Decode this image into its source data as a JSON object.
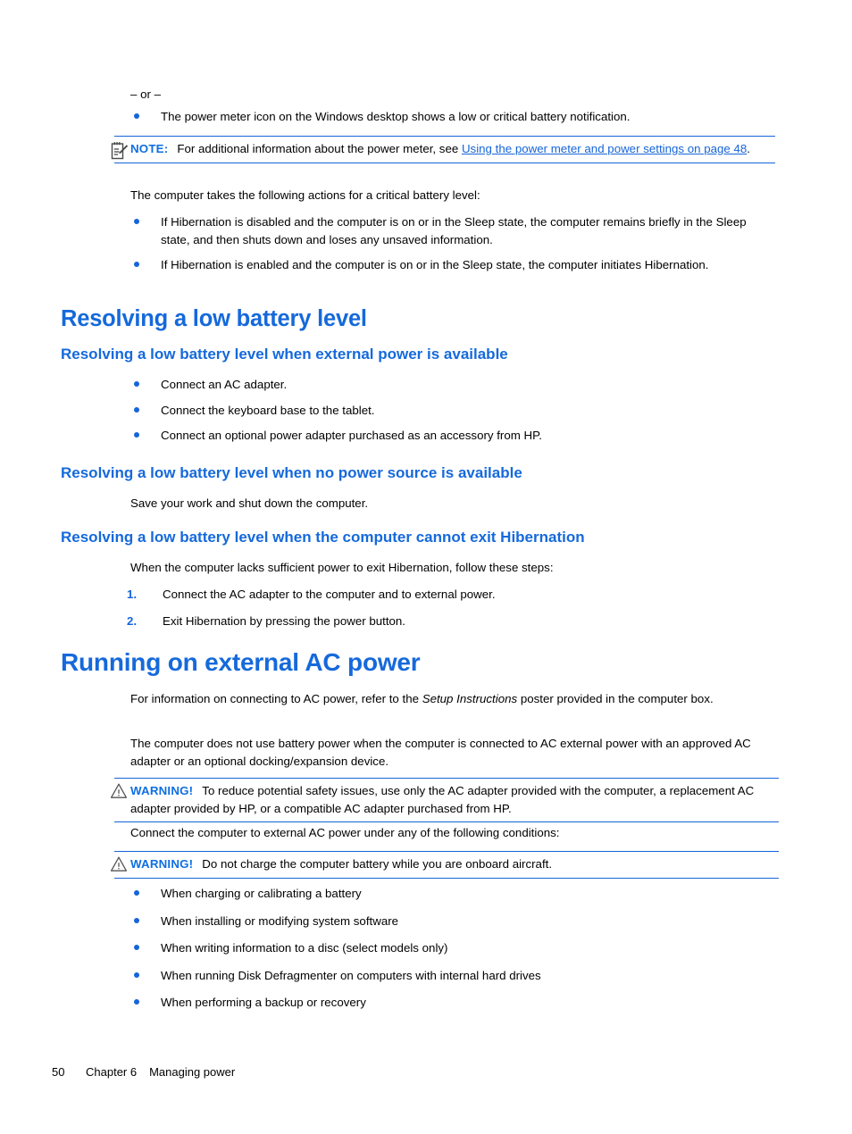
{
  "page": {
    "or_separator": "– or –",
    "footer": {
      "page_number": "50",
      "chapter": "Chapter 6",
      "chapter_title": "Managing power"
    }
  },
  "colors": {
    "heading_blue": "#1569DB",
    "link_blue": "#1565D8",
    "rule_blue": "#1565D8",
    "body_black": "#000000"
  },
  "intro": {
    "bullet_power_meter": "The power meter icon on the Windows desktop shows a low or critical battery notification.",
    "note": {
      "icon": "note-pencil-icon",
      "label": "NOTE:",
      "text_before_link": "For additional information about the power meter, see ",
      "link_text": "Using the power meter and power settings on page 48",
      "text_after_link": "."
    },
    "critical_intro": "The computer takes the following actions for a critical battery level:",
    "critical_bullets": [
      "If Hibernation is disabled and the computer is on or in the Sleep state, the computer remains briefly in the Sleep state, and then shuts down and loses any unsaved information.",
      "If Hibernation is enabled and the computer is on or in the Sleep state, the computer initiates Hibernation."
    ]
  },
  "resolving": {
    "heading": "Resolving a low battery level",
    "external_power": {
      "heading": "Resolving a low battery level when external power is available",
      "bullets": [
        "Connect an AC adapter.",
        "Connect the keyboard base to the tablet.",
        "Connect an optional power adapter purchased as an accessory from HP."
      ]
    },
    "no_power_source": {
      "heading": "Resolving a low battery level when no power source is available",
      "paragraph": "Save your work and shut down the computer."
    },
    "cannot_exit_hibernation": {
      "heading": "Resolving a low battery level when the computer cannot exit Hibernation",
      "paragraph": "When the computer lacks sufficient power to exit Hibernation, follow these steps:",
      "steps": [
        {
          "number": "1.",
          "text": "Connect the AC adapter to the computer and to external power."
        },
        {
          "number": "2.",
          "text": "Exit Hibernation by pressing the power button."
        }
      ]
    }
  },
  "external_ac": {
    "heading": "Running on external AC power",
    "para1_before_italic": "For information on connecting to AC power, refer to the ",
    "para1_italic": "Setup Instructions",
    "para1_after_italic": " poster provided in the computer box.",
    "para2": "The computer does not use battery power when the computer is connected to AC external power with an approved AC adapter or an optional docking/expansion device.",
    "warning1": {
      "icon": "warning-triangle-icon",
      "label": "WARNING!",
      "text": "To reduce potential safety issues, use only the AC adapter provided with the computer, a replacement AC adapter provided by HP, or a compatible AC adapter purchased from HP."
    },
    "conditions_intro": "Connect the computer to external AC power under any of the following conditions:",
    "warning2": {
      "icon": "warning-triangle-icon",
      "label": "WARNING!",
      "text": "Do not charge the computer battery while you are onboard aircraft."
    },
    "conditions": [
      "When charging or calibrating a battery",
      "When installing or modifying system software",
      "When writing information to a disc (select models only)",
      "When running Disk Defragmenter on computers with internal hard drives",
      "When performing a backup or recovery"
    ]
  }
}
